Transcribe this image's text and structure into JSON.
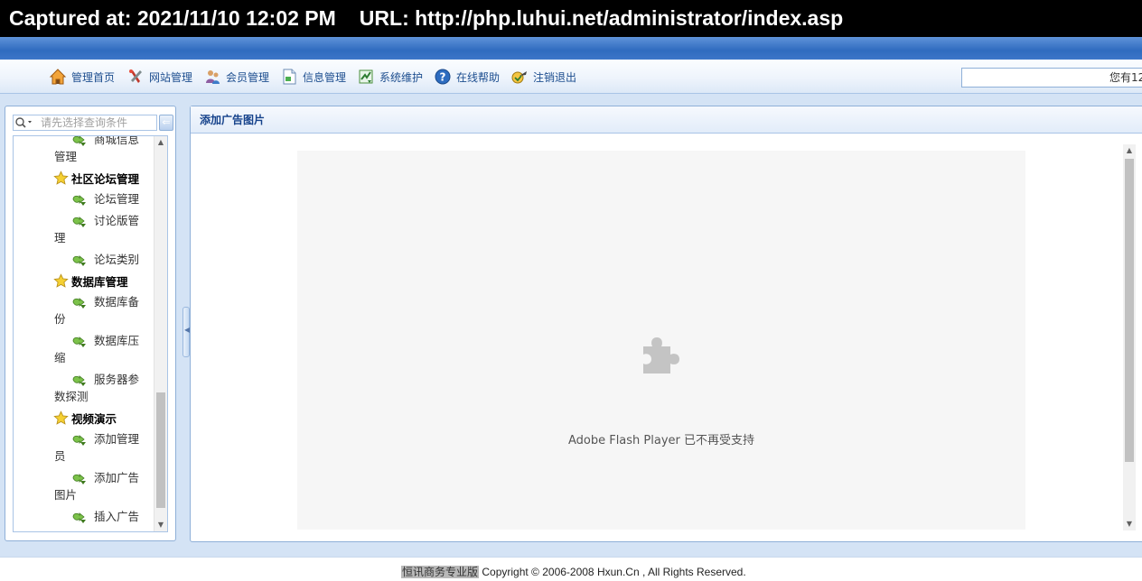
{
  "capture": {
    "timestamp": "Captured at: 2021/11/10 12:02 PM",
    "url": "URL: http://php.luhui.net/administrator/index.asp"
  },
  "nav": {
    "items": [
      {
        "label": "管理首页",
        "icon": "home-icon"
      },
      {
        "label": "网站管理",
        "icon": "tools-icon"
      },
      {
        "label": "会员管理",
        "icon": "users-icon"
      },
      {
        "label": "信息管理",
        "icon": "document-icon"
      },
      {
        "label": "系统维护",
        "icon": "maintenance-icon"
      },
      {
        "label": "在线帮助",
        "icon": "help-icon"
      },
      {
        "label": "注销退出",
        "icon": "logout-icon"
      }
    ],
    "status_text": "您有12"
  },
  "sidebar": {
    "search_placeholder": "请先选择查询条件",
    "collapse_label": "⇐",
    "tree": [
      {
        "type": "leaf",
        "label": "商城信息管理"
      },
      {
        "type": "group",
        "label": "社区论坛管理"
      },
      {
        "type": "leaf",
        "label": "论坛管理"
      },
      {
        "type": "leaf",
        "label": "讨论版管理"
      },
      {
        "type": "leaf",
        "label": "论坛类别"
      },
      {
        "type": "group",
        "label": "数据库管理"
      },
      {
        "type": "leaf",
        "label": "数据库备份"
      },
      {
        "type": "leaf",
        "label": "数据库压缩"
      },
      {
        "type": "leaf",
        "label": "服务器参数探测"
      },
      {
        "type": "group",
        "label": "视频演示"
      },
      {
        "type": "leaf",
        "label": "添加管理员"
      },
      {
        "type": "leaf",
        "label": "添加广告图片"
      },
      {
        "type": "leaf",
        "label": "插入广告"
      }
    ]
  },
  "main": {
    "panel_title": "添加广告图片",
    "flash_message": "Adobe Flash Player 已不再受支持"
  },
  "footer": {
    "brand": "恒讯商务专业版",
    "copyright": " Copyright © 2006-2008 Hxun.Cn , All Rights Reserved."
  },
  "colors": {
    "nav_text": "#1d4e8f",
    "header_band": "#2f6bbf",
    "panel_title": "#15428b"
  }
}
